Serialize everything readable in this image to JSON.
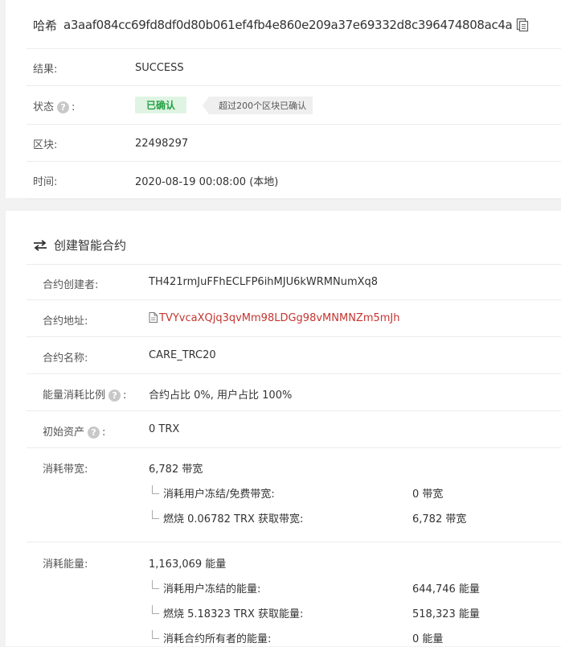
{
  "tx": {
    "hash_label": "哈希",
    "hash_value": "a3aaf084cc69fd8df0d80b061ef4fb4e860e209a37e69332d8c396474808ac4a",
    "result_label": "结果:",
    "result_value": "SUCCESS",
    "status_label": "状态",
    "status_colon": ":",
    "status_badge": "已确认",
    "status_note": "超过200个区块已确认",
    "block_label": "区块:",
    "block_value": "22498297",
    "time_label": "时间:",
    "time_value": "2020-08-19 00:08:00 (本地)"
  },
  "contract": {
    "section_title": "创建智能合约",
    "creator_label": "合约创建者:",
    "creator_value": "TH421rmJuFFhECLFP6ihMJU6kWRMNumXq8",
    "address_label": "合约地址:",
    "address_value": "TVYvcaXQjq3qvMm98LDGg98vMNMNZm5mJh",
    "name_label": "合约名称:",
    "name_value": "CARE_TRC20",
    "ratio_label": "能量消耗比例",
    "ratio_colon": ":",
    "ratio_value": "合约占比 0%, 用户占比 100%",
    "initial_label": "初始资产",
    "initial_colon": ":",
    "initial_value": "0 TRX",
    "bandwidth_label": "消耗带宽:",
    "bandwidth_value": "6,782 带宽",
    "bandwidth_sub": [
      {
        "label": "消耗用户冻结/免费带宽:",
        "value": "0 带宽"
      },
      {
        "label": "燃烧 0.06782 TRX 获取带宽:",
        "value": "6,782 带宽"
      }
    ],
    "energy_label": "消耗能量:",
    "energy_value": "1,163,069 能量",
    "energy_sub": [
      {
        "label": "消耗用户冻结的能量:",
        "value": "644,746 能量"
      },
      {
        "label": "燃烧 5.18323 TRX 获取能量:",
        "value": "518,323 能量"
      },
      {
        "label": "消耗合约所有者的能量:",
        "value": "0 能量"
      }
    ]
  },
  "icons": {
    "copy": "copy-icon",
    "help": "?",
    "swap": "swap-arrows-icon",
    "file": "file-icon"
  }
}
